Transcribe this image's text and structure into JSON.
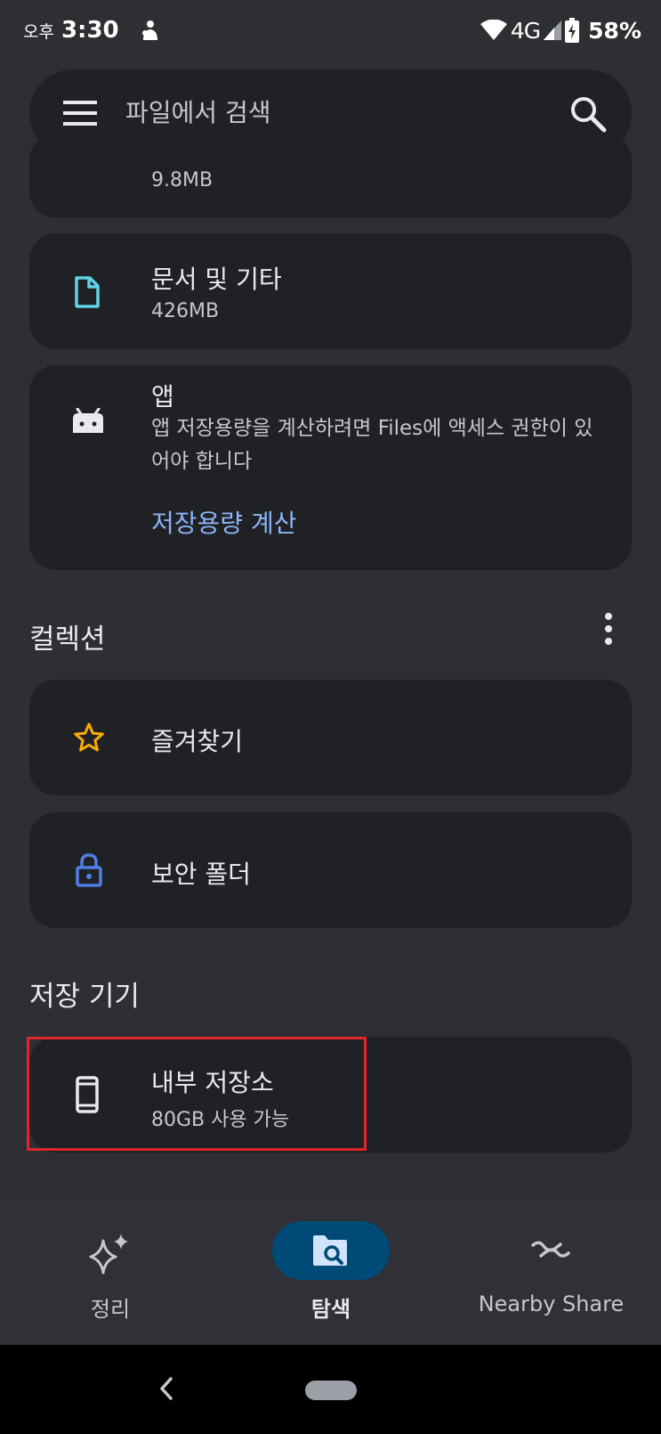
{
  "status_bar": {
    "ampm": "오후",
    "time": "3:30",
    "network": "4G",
    "battery": "58%"
  },
  "search": {
    "placeholder": "파일에서 검색"
  },
  "storage_categories": [
    {
      "name": "partial-card",
      "subtitle": "9.8MB",
      "icon": "partial-icon"
    },
    {
      "name": "documents",
      "title": "문서 및 기타",
      "subtitle": "426MB",
      "icon": "document-icon",
      "icon_color": "#5ed4e6"
    },
    {
      "name": "apps",
      "title": "앱",
      "subtitle": "앱 저장용량을 계산하려면 Files에 액세스 권한이 있\n어야 합니다",
      "action_label": "저장용량 계산",
      "icon": "android-icon"
    }
  ],
  "collections": {
    "header": "컬렉션",
    "items": [
      {
        "title": "즐겨찾기",
        "icon": "star-icon",
        "icon_color": "#f9ab00"
      },
      {
        "title": "보안 폴더",
        "icon": "lock-icon",
        "icon_color": "#4f7ee8"
      }
    ]
  },
  "storage_devices": {
    "header": "저장 기기",
    "items": [
      {
        "title": "내부 저장소",
        "subtitle": "80GB 사용 가능",
        "icon": "phone-icon"
      }
    ]
  },
  "bottom_nav": [
    {
      "label": "정리",
      "icon": "sparkle-icon",
      "selected": false
    },
    {
      "label": "탐색",
      "icon": "folder-search-icon",
      "selected": true
    },
    {
      "label": "Nearby Share",
      "icon": "nearby-share-icon",
      "selected": false
    }
  ],
  "colors": {
    "accent_link": "#8ab4f8",
    "highlight_box": "#e0262b",
    "selected_pill": "#004a77"
  }
}
